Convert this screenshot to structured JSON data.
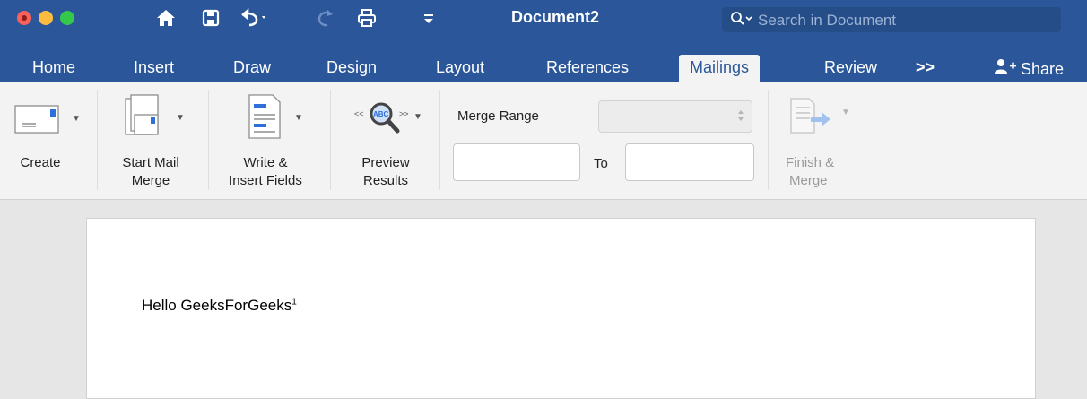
{
  "window": {
    "title": "Document2",
    "search_placeholder": "Search in Document"
  },
  "quick_access": {
    "icons": [
      "home-icon",
      "save-icon",
      "undo-icon",
      "redo-icon",
      "print-icon",
      "customize-icon"
    ]
  },
  "tabs": [
    {
      "label": "Home"
    },
    {
      "label": "Insert"
    },
    {
      "label": "Draw"
    },
    {
      "label": "Design"
    },
    {
      "label": "Layout"
    },
    {
      "label": "References"
    },
    {
      "label": "Mailings",
      "active": true
    },
    {
      "label": "Review"
    },
    {
      "label": ">>"
    },
    {
      "label": "Share"
    }
  ],
  "ribbon": {
    "create_label": "Create",
    "start_mail_merge_label_1": "Start Mail",
    "start_mail_merge_label_2": "Merge",
    "write_insert_label_1": "Write &",
    "write_insert_label_2": "Insert Fields",
    "preview_label_1": "Preview",
    "preview_label_2": "Results",
    "merge_range_label": "Merge Range",
    "to_label": "To",
    "finish_label_1": "Finish &",
    "finish_label_2": "Merge",
    "preview_icon_text": "ABC"
  },
  "document": {
    "text": "Hello GeeksForGeeks",
    "footnote_mark": "1"
  },
  "colors": {
    "titlebar": "#2b579a",
    "ribbon": "#f3f3f3"
  }
}
